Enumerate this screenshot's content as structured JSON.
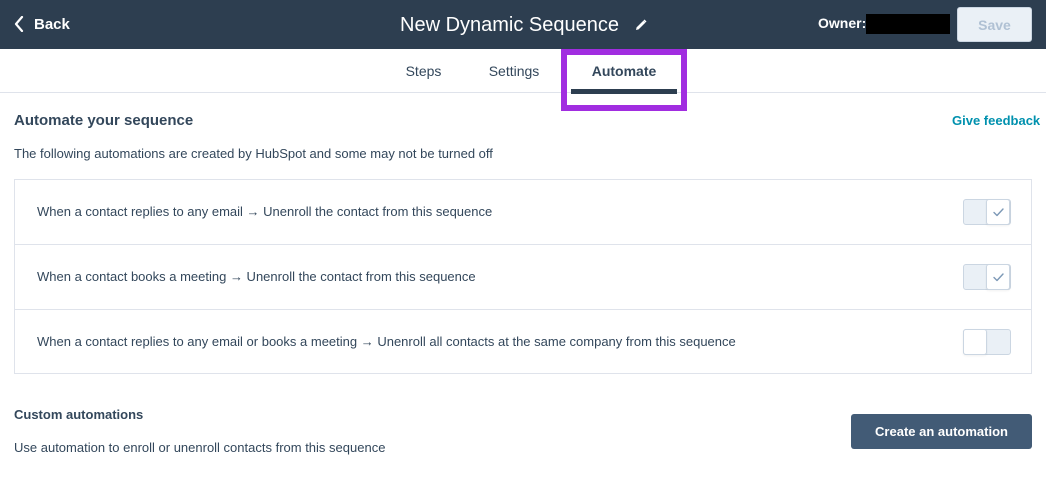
{
  "header": {
    "back_label": "Back",
    "title": "New Dynamic Sequence",
    "owner_label": "Owner:",
    "save_label": "Save"
  },
  "tabs": [
    {
      "label": "Steps"
    },
    {
      "label": "Settings"
    },
    {
      "label": "Automate",
      "active": true
    }
  ],
  "feedback_label": "Give feedback",
  "automate": {
    "heading": "Automate your sequence",
    "subtext": "The following automations are created by HubSpot and some may not be turned off",
    "rules": [
      {
        "text": "When a contact replies to any email → Unenroll the contact from this sequence",
        "enabled": true
      },
      {
        "text": "When a contact books a meeting → Unenroll the contact from this sequence",
        "enabled": true
      },
      {
        "text": "When a contact replies to any email or books a meeting → Unenroll all contacts at the same company from this sequence",
        "enabled": false
      }
    ]
  },
  "custom": {
    "heading": "Custom automations",
    "text": "Use automation to enroll or unenroll contacts from this sequence",
    "button_label": "Create an automation"
  },
  "colors": {
    "header_bg": "#2d3e50",
    "highlight": "#a12de0",
    "link": "#0091ae",
    "primary_button": "#425b76"
  }
}
